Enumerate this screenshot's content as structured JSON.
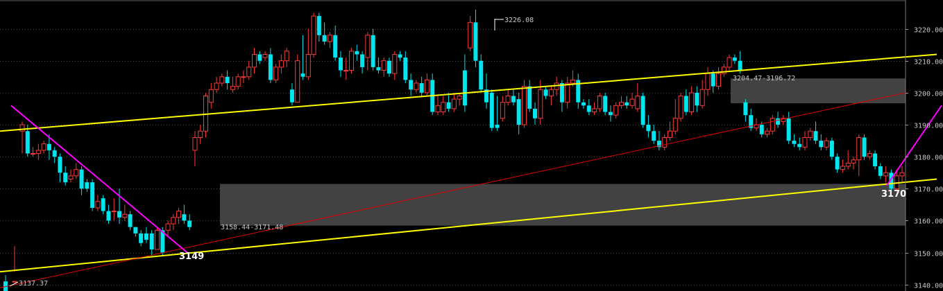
{
  "chart_data": {
    "type": "candlestick",
    "ylim": [
      3138,
      3229
    ],
    "y_ticks": [
      3140,
      3150,
      3160,
      3170,
      3180,
      3190,
      3200,
      3210,
      3220
    ],
    "y_tick_labels": [
      "3140.00",
      "3150.00",
      "3160.00",
      "3170.00",
      "3180.00",
      "3190.00",
      "3200.00",
      "3210.00",
      "3220.00"
    ],
    "grid": true,
    "colors": {
      "up": "#ff3a3a",
      "down": "#00e5ee",
      "trend": "#ffff00",
      "support": "#e00000",
      "swing": "#ff00ff",
      "zone": "#4d4d4d",
      "grid": "#4a4a4a"
    },
    "candles": [
      [
        3141,
        3138,
        3143,
        3140
      ],
      [
        3141,
        3141,
        3152,
        3144
      ],
      [
        3188,
        3190,
        3181,
        3191
      ],
      [
        3188,
        3181,
        3180,
        3190
      ],
      [
        3181,
        3181,
        3180,
        3183
      ],
      [
        3181,
        3182,
        3179,
        3184
      ],
      [
        3182,
        3184,
        3181,
        3185
      ],
      [
        3184,
        3182,
        3179,
        3187
      ],
      [
        3182,
        3180,
        3178,
        3183
      ],
      [
        3180,
        3175,
        3172,
        3181
      ],
      [
        3175,
        3172,
        3171,
        3177
      ],
      [
        3173,
        3174,
        3172,
        3176
      ],
      [
        3174,
        3176,
        3173,
        3178
      ],
      [
        3176,
        3170,
        3168,
        3177
      ],
      [
        3172,
        3170,
        3169,
        3173
      ],
      [
        3172,
        3164,
        3163,
        3173
      ],
      [
        3164,
        3166,
        3163,
        3168
      ],
      [
        3167,
        3163,
        3162,
        3168
      ],
      [
        3163,
        3160,
        3159,
        3165
      ],
      [
        3163,
        3163,
        3160,
        3167
      ],
      [
        3163,
        3161,
        3159,
        3170
      ],
      [
        3161,
        3162,
        3160,
        3165
      ],
      [
        3162,
        3158,
        3157,
        3163
      ],
      [
        3158,
        3156,
        3155,
        3158
      ],
      [
        3156,
        3153,
        3152,
        3157
      ],
      [
        3156,
        3154,
        3153,
        3158
      ],
      [
        3156,
        3151,
        3149,
        3157
      ],
      [
        3151,
        3157,
        3151,
        3158
      ],
      [
        3157,
        3150,
        3149,
        3158
      ],
      [
        3157,
        3159,
        3155,
        3160
      ],
      [
        3159,
        3161,
        3157,
        3162
      ],
      [
        3161,
        3163,
        3159,
        3164
      ],
      [
        3162,
        3160,
        3159,
        3165
      ],
      [
        3160,
        3158,
        3157,
        3162
      ],
      [
        3182,
        3186,
        3177,
        3188
      ],
      [
        3186,
        3188,
        3184,
        3190
      ],
      [
        3188,
        3199,
        3186,
        3200
      ],
      [
        3197,
        3201,
        3195,
        3203
      ],
      [
        3201,
        3203,
        3200,
        3205
      ],
      [
        3203,
        3205,
        3202,
        3206
      ],
      [
        3205,
        3203,
        3201,
        3207
      ],
      [
        3201,
        3202,
        3200,
        3205
      ],
      [
        3202,
        3205,
        3201,
        3206
      ],
      [
        3205,
        3205,
        3203,
        3207
      ],
      [
        3205,
        3208,
        3204,
        3210
      ],
      [
        3208,
        3212,
        3206,
        3214
      ],
      [
        3212,
        3210,
        3209,
        3213
      ],
      [
        3211,
        3212,
        3210,
        3213
      ],
      [
        3212,
        3204,
        3203,
        3214
      ],
      [
        3204,
        3208,
        3203,
        3209
      ],
      [
        3208,
        3210,
        3206,
        3212
      ],
      [
        3210,
        3213,
        3208,
        3214
      ],
      [
        3201,
        3197,
        3196,
        3203
      ],
      [
        3197,
        3210,
        3197,
        3212
      ],
      [
        3206,
        3205,
        3204,
        3218
      ],
      [
        3205,
        3212,
        3204,
        3220
      ],
      [
        3212,
        3224,
        3211,
        3225
      ],
      [
        3224,
        3218,
        3216,
        3225
      ],
      [
        3218,
        3216,
        3215,
        3222
      ],
      [
        3216,
        3218,
        3214,
        3219
      ],
      [
        3218,
        3211,
        3210,
        3221
      ],
      [
        3211,
        3207,
        3205,
        3213
      ],
      [
        3207,
        3207,
        3204,
        3211
      ],
      [
        3207,
        3213,
        3206,
        3214
      ],
      [
        3213,
        3212,
        3210,
        3215
      ],
      [
        3212,
        3208,
        3206,
        3213
      ],
      [
        3211,
        3218,
        3207,
        3219
      ],
      [
        3218,
        3208,
        3207,
        3220
      ],
      [
        3208,
        3207,
        3206,
        3211
      ],
      [
        3207,
        3210,
        3205,
        3211
      ],
      [
        3210,
        3206,
        3205,
        3211
      ],
      [
        3206,
        3212,
        3204,
        3213
      ],
      [
        3212,
        3211,
        3210,
        3213
      ],
      [
        3211,
        3204,
        3203,
        3213
      ],
      [
        3204,
        3201,
        3199,
        3206
      ],
      [
        3201,
        3203,
        3200,
        3204
      ],
      [
        3203,
        3200,
        3199,
        3205
      ],
      [
        3200,
        3204,
        3199,
        3206
      ],
      [
        3204,
        3194,
        3193,
        3206
      ],
      [
        3194,
        3196,
        3193,
        3199
      ],
      [
        3194,
        3197,
        3193,
        3199
      ],
      [
        3197,
        3195,
        3194,
        3200
      ],
      [
        3195,
        3198,
        3194,
        3200
      ],
      [
        3198,
        3199,
        3196,
        3200
      ],
      [
        3207,
        3196,
        3194,
        3212
      ],
      [
        3214,
        3222,
        3213,
        3224
      ],
      [
        3222,
        3210,
        3208,
        3226
      ],
      [
        3210,
        3201,
        3200,
        3212
      ],
      [
        3201,
        3197,
        3195,
        3206
      ],
      [
        3200,
        3189,
        3188,
        3201
      ],
      [
        3190,
        3189,
        3188,
        3199
      ],
      [
        3192,
        3197,
        3191,
        3199
      ],
      [
        3197,
        3199,
        3196,
        3201
      ],
      [
        3199,
        3197,
        3196,
        3201
      ],
      [
        3198,
        3190,
        3187,
        3200
      ],
      [
        3190,
        3202,
        3189,
        3204
      ],
      [
        3202,
        3195,
        3194,
        3204
      ],
      [
        3195,
        3192,
        3190,
        3197
      ],
      [
        3192,
        3201,
        3190,
        3204
      ],
      [
        3201,
        3199,
        3198,
        3202
      ],
      [
        3199,
        3201,
        3196,
        3202
      ],
      [
        3201,
        3203,
        3199,
        3205
      ],
      [
        3203,
        3197,
        3194,
        3204
      ],
      [
        3197,
        3203,
        3195,
        3205
      ],
      [
        3203,
        3204,
        3202,
        3207
      ],
      [
        3204,
        3197,
        3195,
        3206
      ],
      [
        3197,
        3196,
        3195,
        3198
      ],
      [
        3196,
        3194,
        3193,
        3198
      ],
      [
        3194,
        3195,
        3193,
        3197
      ],
      [
        3195,
        3199,
        3194,
        3200
      ],
      [
        3199,
        3194,
        3193,
        3200
      ],
      [
        3194,
        3193,
        3191,
        3196
      ],
      [
        3193,
        3196,
        3192,
        3197
      ],
      [
        3196,
        3197,
        3195,
        3199
      ],
      [
        3197,
        3196,
        3195,
        3199
      ],
      [
        3196,
        3198,
        3195,
        3200
      ],
      [
        3195,
        3199,
        3194,
        3203
      ],
      [
        3199,
        3190,
        3189,
        3200
      ],
      [
        3190,
        3188,
        3186,
        3193
      ],
      [
        3188,
        3185,
        3184,
        3190
      ],
      [
        3185,
        3183,
        3182,
        3188
      ],
      [
        3183,
        3186,
        3182,
        3187
      ],
      [
        3186,
        3188,
        3185,
        3191
      ],
      [
        3188,
        3192,
        3187,
        3198
      ],
      [
        3192,
        3199,
        3191,
        3200
      ],
      [
        3199,
        3194,
        3193,
        3201
      ],
      [
        3194,
        3200,
        3193,
        3202
      ],
      [
        3200,
        3196,
        3194,
        3202
      ],
      [
        3196,
        3201,
        3195,
        3204
      ],
      [
        3201,
        3206,
        3199,
        3208
      ],
      [
        3206,
        3202,
        3200,
        3207
      ],
      [
        3202,
        3206,
        3201,
        3208
      ],
      [
        3206,
        3208,
        3205,
        3209
      ],
      [
        3208,
        3211,
        3207,
        3212
      ],
      [
        3211,
        3210,
        3209,
        3212
      ],
      [
        3210,
        3207,
        3206,
        3213
      ],
      [
        3197,
        3193,
        3191,
        3198
      ],
      [
        3193,
        3189,
        3188,
        3195
      ],
      [
        3189,
        3190,
        3188,
        3192
      ],
      [
        3190,
        3187,
        3186,
        3191
      ],
      [
        3187,
        3188,
        3186,
        3189
      ],
      [
        3188,
        3192,
        3187,
        3193
      ],
      [
        3192,
        3190,
        3189,
        3194
      ],
      [
        3191,
        3192,
        3190,
        3193
      ],
      [
        3192,
        3185,
        3184,
        3194
      ],
      [
        3185,
        3184,
        3183,
        3187
      ],
      [
        3184,
        3183,
        3182,
        3186
      ],
      [
        3183,
        3186,
        3182,
        3188
      ],
      [
        3186,
        3188,
        3185,
        3189
      ],
      [
        3188,
        3185,
        3184,
        3191
      ],
      [
        3185,
        3183,
        3182,
        3187
      ],
      [
        3183,
        3185,
        3182,
        3186
      ],
      [
        3185,
        3180,
        3179,
        3186
      ],
      [
        3180,
        3176,
        3175,
        3181
      ],
      [
        3176,
        3177,
        3175,
        3179
      ],
      [
        3177,
        3178,
        3176,
        3182
      ],
      [
        3178,
        3179,
        3176,
        3180
      ],
      [
        3179,
        3186,
        3174,
        3187
      ],
      [
        3186,
        3180,
        3179,
        3187
      ],
      [
        3180,
        3181,
        3179,
        3182
      ],
      [
        3181,
        3177,
        3176,
        3182
      ],
      [
        3177,
        3174,
        3173,
        3178
      ],
      [
        3174,
        3175,
        3172,
        3177
      ],
      [
        3175,
        3170,
        3169,
        3176
      ],
      [
        3170,
        3174,
        3169,
        3176
      ],
      [
        3174,
        3175,
        3172,
        3177
      ]
    ],
    "trend_lines": [
      {
        "name": "upper-channel",
        "from": [
          3188,
          "start"
        ],
        "to": [
          3212,
          "end"
        ]
      },
      {
        "name": "lower-channel",
        "from": [
          3144,
          "start"
        ],
        "to": [
          3173,
          "end"
        ]
      },
      {
        "name": "support-line",
        "from": [
          3139,
          "start"
        ],
        "to": [
          3200,
          "end"
        ]
      }
    ],
    "swing_lines": [
      {
        "name": "downtrend",
        "from": 3196,
        "to": 3150
      },
      {
        "name": "rebound",
        "from": 3171,
        "to": 3196
      }
    ],
    "zones": [
      {
        "label": "3158.44-3171.48",
        "low": 3158.44,
        "high": 3171.48
      },
      {
        "label": "3204.47-3196.72",
        "low": 3196.72,
        "high": 3204.47
      }
    ],
    "annotations": {
      "high": "3226.08",
      "low": "3137.37",
      "pivot_low": "3149",
      "pivot_recent": "3170"
    }
  }
}
